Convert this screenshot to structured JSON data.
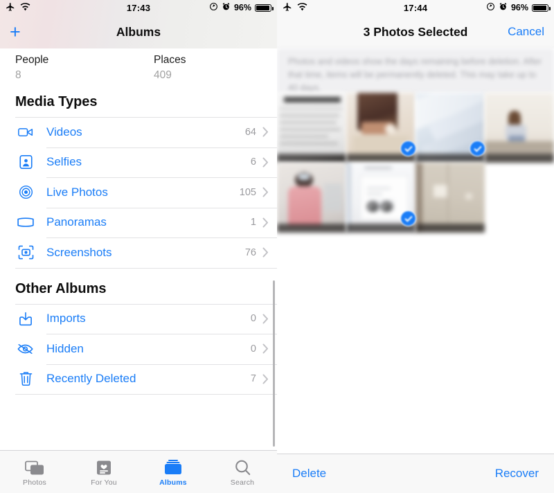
{
  "left": {
    "status_bar": {
      "airplane_icon": "airplane-icon",
      "wifi_icon": "wifi-icon",
      "time": "17:43",
      "location_icon": "location-arrow-icon",
      "alarm_icon": "alarm-clock-icon",
      "battery_percent": "96%",
      "battery_icon": "battery-full-icon"
    },
    "nav": {
      "add_label": "+",
      "title": "Albums"
    },
    "top_albums": [
      {
        "title": "People",
        "count": "8"
      },
      {
        "title": "Places",
        "count": "409"
      }
    ],
    "media_types": {
      "header": "Media Types",
      "items": [
        {
          "icon": "video-camera-icon",
          "label": "Videos",
          "count": "64"
        },
        {
          "icon": "selfie-portrait-icon",
          "label": "Selfies",
          "count": "6"
        },
        {
          "icon": "live-photo-icon",
          "label": "Live Photos",
          "count": "105"
        },
        {
          "icon": "panorama-icon",
          "label": "Panoramas",
          "count": "1"
        },
        {
          "icon": "screenshot-icon",
          "label": "Screenshots",
          "count": "76"
        }
      ]
    },
    "other_albums": {
      "header": "Other Albums",
      "items": [
        {
          "icon": "import-icon",
          "label": "Imports",
          "count": "0"
        },
        {
          "icon": "eye-slash-icon",
          "label": "Hidden",
          "count": "0"
        },
        {
          "icon": "trash-icon",
          "label": "Recently Deleted",
          "count": "7"
        }
      ]
    },
    "tabbar": {
      "tabs": [
        {
          "icon": "photos-stack-icon",
          "label": "Photos",
          "active": false
        },
        {
          "icon": "for-you-heart-card-icon",
          "label": "For You",
          "active": false
        },
        {
          "icon": "albums-folder-icon",
          "label": "Albums",
          "active": true
        },
        {
          "icon": "magnifier-icon",
          "label": "Search",
          "active": false
        }
      ]
    },
    "accent_color": "#1a7df7",
    "inactive_tab_color": "#8a8a8e"
  },
  "right": {
    "status_bar": {
      "airplane_icon": "airplane-icon",
      "wifi_icon": "wifi-icon",
      "time": "17:44",
      "location_icon": "location-arrow-icon",
      "alarm_icon": "alarm-clock-icon",
      "battery_percent": "96%",
      "battery_icon": "battery-full-icon"
    },
    "nav": {
      "title": "3 Photos Selected",
      "cancel_label": "Cancel"
    },
    "notice_text": "Photos and videos show the days remaining before deletion. After that time, items will be permanently deleted. This may take up to 40 days.",
    "grid": {
      "rows": [
        [
          {
            "name": "photo-thumbnail-1",
            "selected": false
          },
          {
            "name": "photo-thumbnail-2",
            "selected": true
          },
          {
            "name": "photo-thumbnail-3",
            "selected": true
          },
          {
            "name": "photo-thumbnail-4",
            "selected": false
          }
        ],
        [
          {
            "name": "photo-thumbnail-5",
            "selected": false
          },
          {
            "name": "photo-thumbnail-6",
            "selected": true
          },
          {
            "name": "photo-thumbnail-7",
            "selected": false
          }
        ]
      ],
      "selected_count": 3,
      "checkmark_color": "#1a7df7"
    },
    "bottom_bar": {
      "delete_label": "Delete",
      "recover_label": "Recover"
    },
    "accent_color": "#1a7df7"
  }
}
